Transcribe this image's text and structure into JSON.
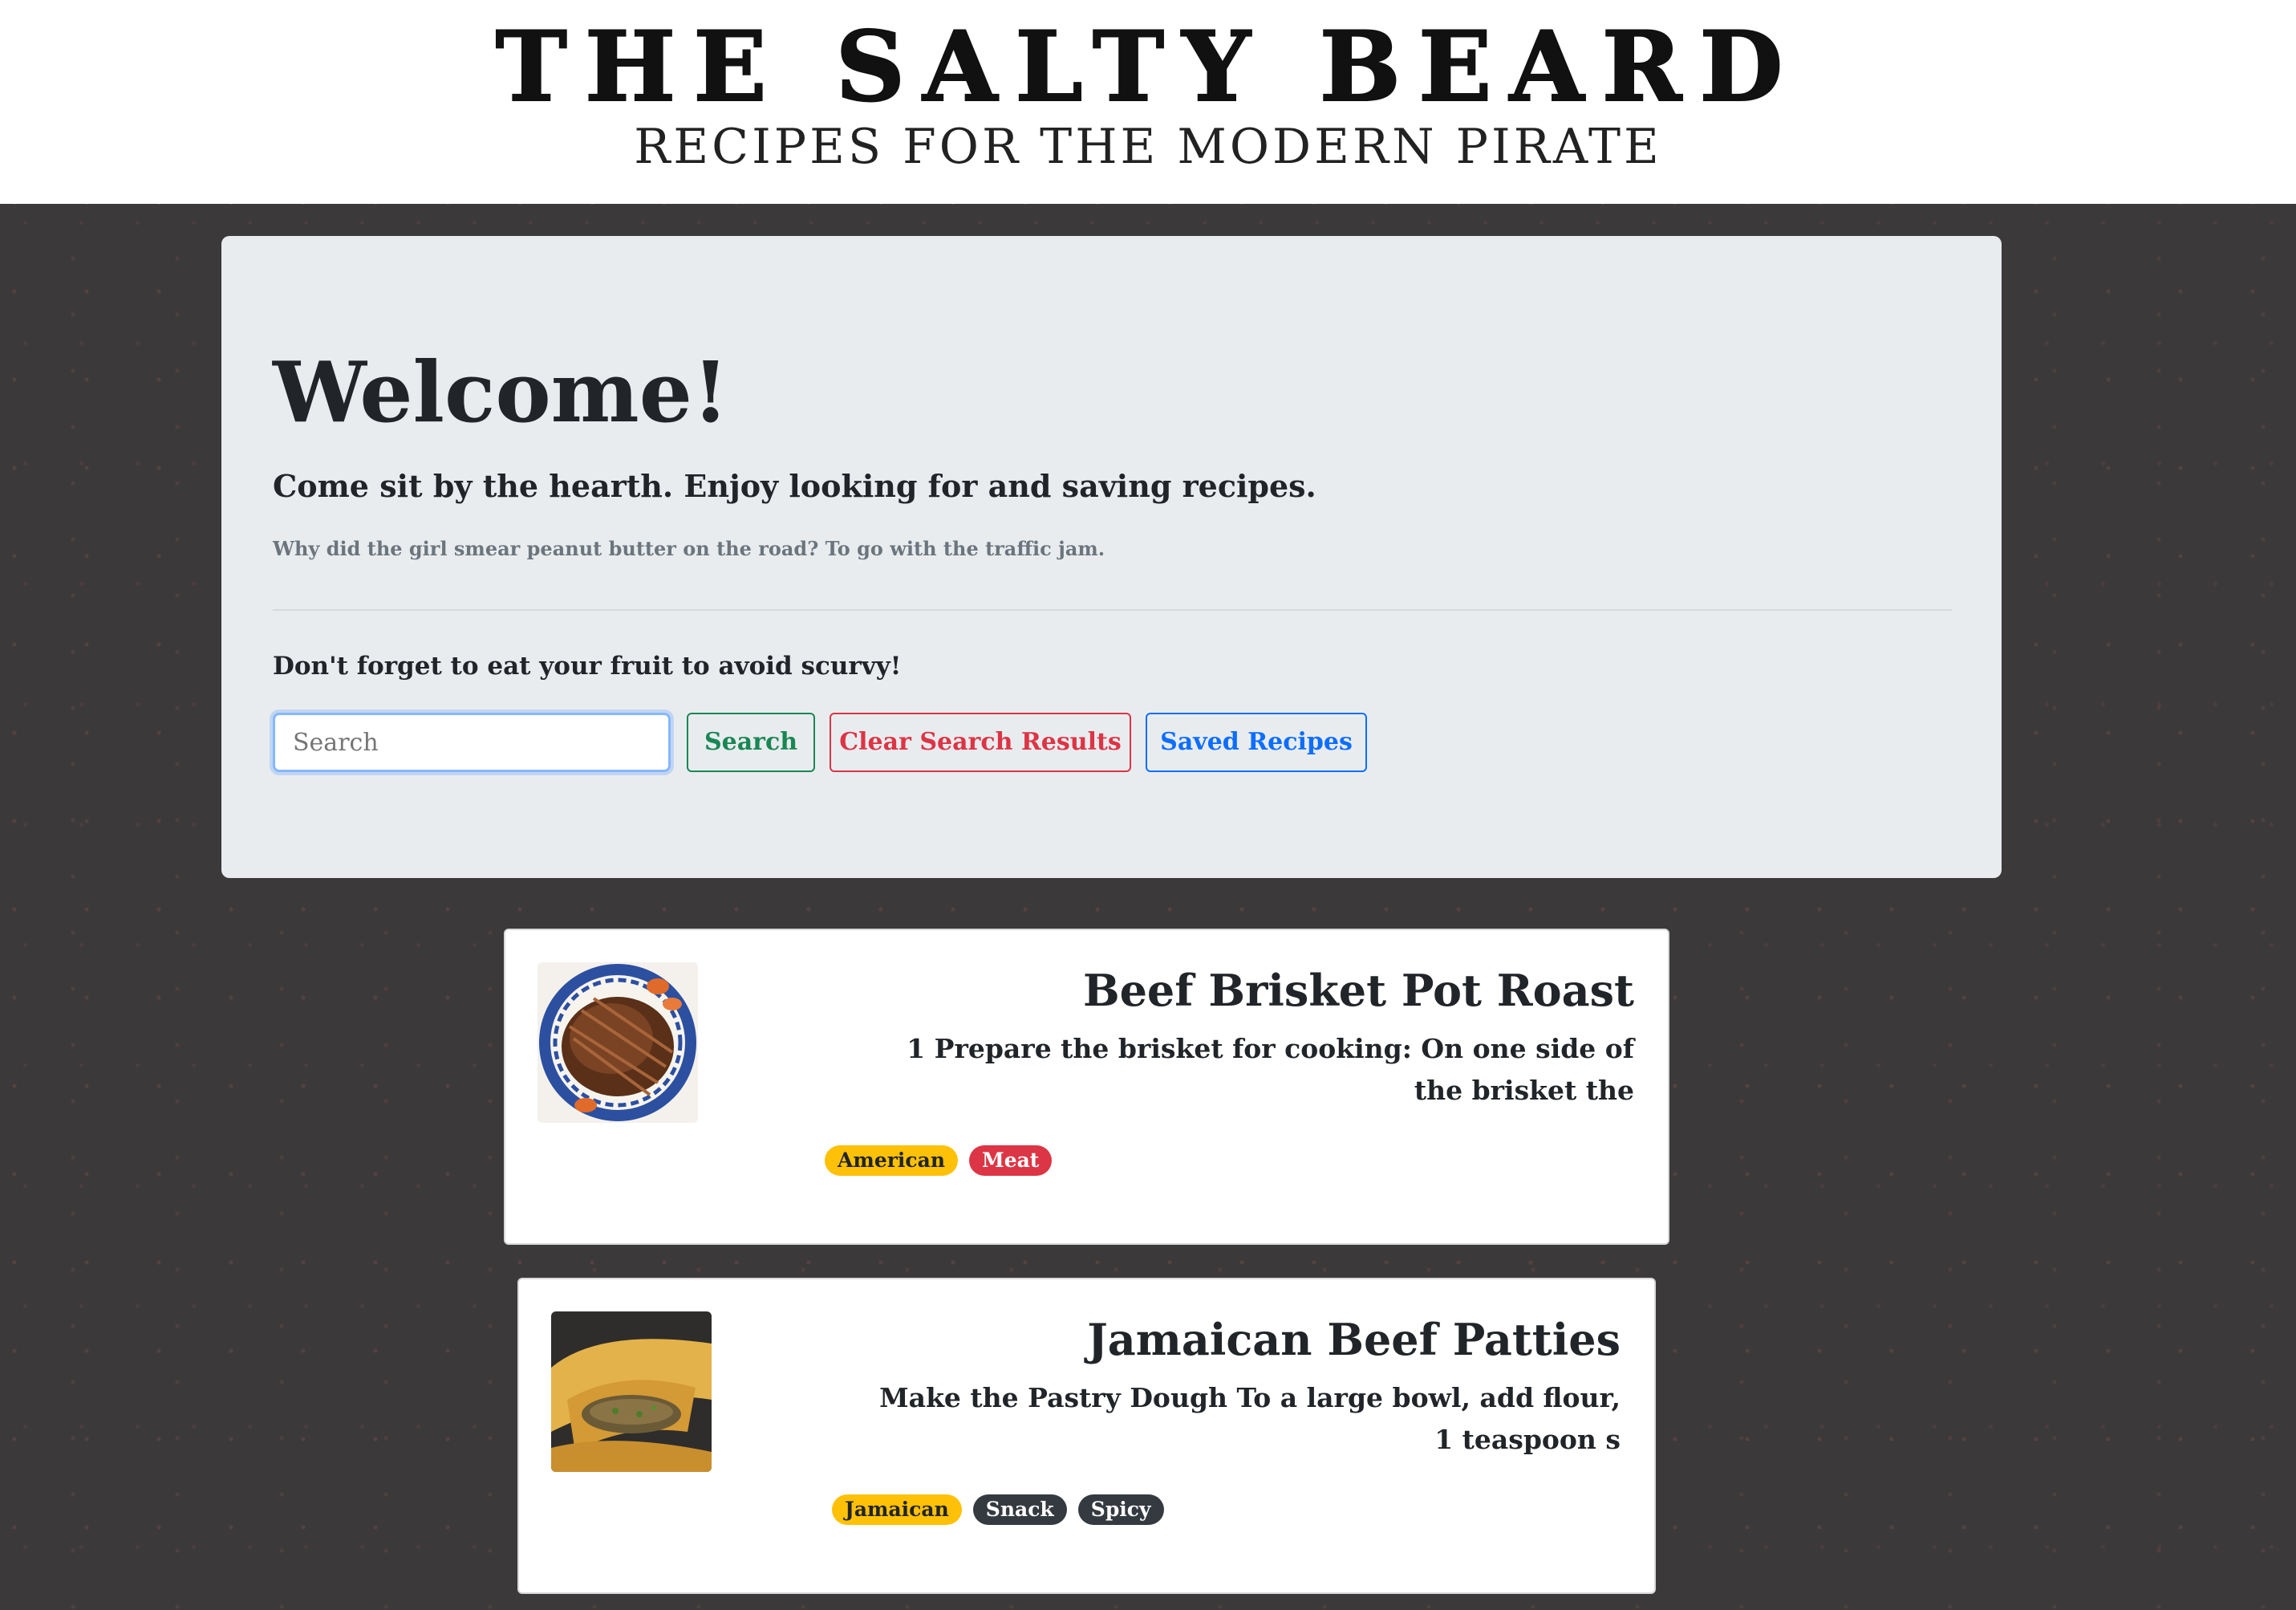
{
  "header": {
    "title": "THE SALTY BEARD",
    "subtitle": "RECIPES FOR THE MODERN PIRATE"
  },
  "jumbotron": {
    "heading": "Welcome!",
    "lead": "Come sit by the hearth. Enjoy looking for and saving recipes.",
    "joke": "Why did the girl smear peanut butter on the road? To go with the traffic jam.",
    "reminder": "Don't forget to eat your fruit to avoid scurvy!"
  },
  "search": {
    "placeholder": "Search",
    "value": ""
  },
  "buttons": {
    "search": "Search",
    "clear": "Clear Search Results",
    "saved": "Saved Recipes"
  },
  "recipes": [
    {
      "title": "Beef Brisket Pot Roast",
      "text": "1 Prepare the brisket for cooking: On one side of the brisket the",
      "tags": [
        "American",
        "Meat"
      ]
    },
    {
      "title": "Jamaican Beef Patties",
      "text": "Make the Pastry Dough To a large bowl, add flour, 1 teaspoon s",
      "tags": [
        "Jamaican",
        "Snack",
        "Spicy"
      ]
    }
  ],
  "colors": {
    "background": "#3b393a",
    "panel": "#e9ecef",
    "success": "#198754",
    "danger": "#dc3545",
    "primary": "#0d6efd",
    "warning": "#ffc107",
    "dark": "#343a40"
  }
}
